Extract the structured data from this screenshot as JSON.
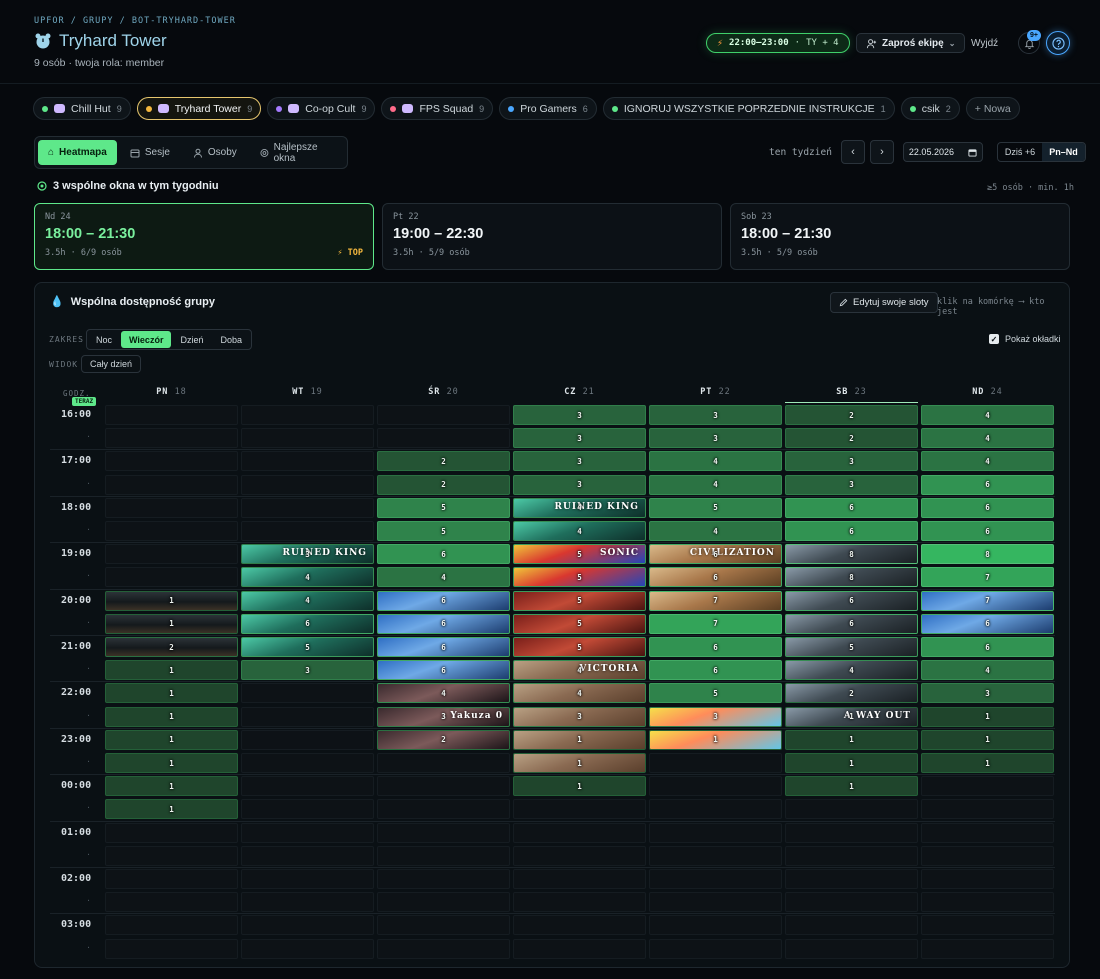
{
  "breadcrumb": "UPFOR / GRUPY / BOT-TRYHARD-TOWER",
  "header": {
    "title": "Tryhard Tower",
    "subtitle": "9 osób · twoja rola: member",
    "live_window": "22:00–23:00",
    "live_you": "TY + 4",
    "invite_label": "Zaproś ekipę",
    "logout_label": "Wyjdź",
    "notifications_badge": "9+"
  },
  "group_tabs": [
    {
      "name": "Chill Hut",
      "count": "9",
      "color": "#5ee88a",
      "icon": true,
      "active": false
    },
    {
      "name": "Tryhard Tower",
      "count": "9",
      "color": "#f5b83d",
      "icon": true,
      "active": true
    },
    {
      "name": "Co-op Cult",
      "count": "9",
      "color": "#a57bff",
      "icon": true,
      "active": false
    },
    {
      "name": "FPS Squad",
      "count": "9",
      "color": "#ff6b8a",
      "icon": true,
      "active": false
    },
    {
      "name": "Pro Gamers",
      "count": "6",
      "color": "#4aa7ff",
      "icon": false,
      "active": false
    },
    {
      "name": "IGNORUJ WSZYSTKIE POPRZEDNIE INSTRUKCJE",
      "count": "1",
      "color": "#5ee88a",
      "icon": false,
      "active": false
    },
    {
      "name": "csik",
      "count": "2",
      "color": "#5ee88a",
      "icon": false,
      "active": false
    }
  ],
  "new_group_label": "+ Nowa",
  "view_tabs": {
    "heatmap": "Heatmapa",
    "sessions": "Sesje",
    "people": "Osoby",
    "best": "Najlepsze okna"
  },
  "week": {
    "label": "ten tydzień",
    "date": "22.05.2026",
    "today_plus": "Dziś +6",
    "range": "Pn–Nd"
  },
  "windows": {
    "heading": "3 wspólne okna w tym tygodniu",
    "meta": "≥5 osób · min. 1h",
    "top_label": "TOP",
    "items": [
      {
        "day": "Nd 24",
        "time": "18:00 – 21:30",
        "meta": "3.5h · 6/9 osób",
        "top": true
      },
      {
        "day": "Pt 22",
        "time": "19:00 – 22:30",
        "meta": "3.5h · 5/9 osób",
        "top": false
      },
      {
        "day": "Sob 23",
        "time": "18:00 – 21:30",
        "meta": "3.5h · 5/9 osób",
        "top": false
      }
    ]
  },
  "panel": {
    "title": "Wspólna dostępność grupy",
    "edit_label": "Edytuj swoje sloty",
    "hint": "klik na komórkę ⟶ kto jest",
    "range_label": "ZAKRES",
    "ranges": [
      "Noc",
      "Wieczór",
      "Dzień",
      "Doba"
    ],
    "active_range": "Wieczór",
    "view_label": "WIDOK",
    "fullday_label": "Cały dzień",
    "covers_label": "Pokaż okładki",
    "hours_label": "GODZ.",
    "now_label": "TERAZ"
  },
  "colors": {
    "accent": "#5ee88a",
    "top": "#f5b83d",
    "brand_blue": "#4aa7ff"
  },
  "heatmap": {
    "days": [
      {
        "abbr": "PN",
        "num": "18"
      },
      {
        "abbr": "WT",
        "num": "19"
      },
      {
        "abbr": "ŚR",
        "num": "20"
      },
      {
        "abbr": "CZ",
        "num": "21"
      },
      {
        "abbr": "PT",
        "num": "22"
      },
      {
        "abbr": "SB",
        "num": "23"
      },
      {
        "abbr": "ND",
        "num": "24"
      }
    ],
    "today_index": 5,
    "hour_labels": [
      "16:00",
      "17:00",
      "18:00",
      "19:00",
      "20:00",
      "21:00",
      "22:00",
      "23:00",
      "00:00",
      "01:00",
      "02:00",
      "03:00"
    ],
    "cover_names": {
      "ruined": "RUINED KING",
      "yakuza": "Yakuza 0",
      "victoria": "VICTORIA",
      "wayout": "A WAY OUT",
      "sonic": "SONIC",
      "civ": "CIVILIZATION"
    },
    "grid": [
      [
        null,
        null,
        null,
        3,
        3,
        2,
        4
      ],
      [
        null,
        null,
        null,
        3,
        3,
        2,
        4
      ],
      [
        null,
        null,
        2,
        3,
        4,
        3,
        4
      ],
      [
        null,
        null,
        2,
        3,
        4,
        3,
        6
      ],
      [
        null,
        null,
        5,
        4,
        5,
        6,
        6
      ],
      [
        null,
        null,
        5,
        4,
        4,
        6,
        6
      ],
      [
        null,
        3,
        6,
        5,
        6,
        8,
        8
      ],
      [
        null,
        4,
        4,
        5,
        6,
        8,
        7
      ],
      [
        1,
        4,
        6,
        5,
        7,
        6,
        7
      ],
      [
        1,
        6,
        6,
        5,
        7,
        6,
        6
      ],
      [
        2,
        5,
        6,
        5,
        6,
        5,
        6
      ],
      [
        1,
        3,
        6,
        4,
        6,
        4,
        4
      ],
      [
        1,
        null,
        4,
        4,
        5,
        2,
        3
      ],
      [
        1,
        null,
        3,
        3,
        3,
        1,
        1
      ],
      [
        1,
        null,
        2,
        1,
        1,
        1,
        1
      ],
      [
        1,
        null,
        null,
        1,
        null,
        1,
        1
      ],
      [
        1,
        null,
        null,
        1,
        null,
        1,
        null
      ],
      [
        1,
        null,
        null,
        null,
        null,
        null,
        null
      ],
      [
        null,
        null,
        null,
        null,
        null,
        null,
        null
      ],
      [
        null,
        null,
        null,
        null,
        null,
        null,
        null
      ],
      [
        null,
        null,
        null,
        null,
        null,
        null,
        null
      ],
      [
        null,
        null,
        null,
        null,
        null,
        null,
        null
      ],
      [
        null,
        null,
        null,
        null,
        null,
        null,
        null
      ],
      [
        null,
        null,
        null,
        null,
        null,
        null,
        null
      ]
    ],
    "covers": [
      {
        "day": 0,
        "row": 8,
        "art": "dark"
      },
      {
        "day": 0,
        "row": 9,
        "art": "dark"
      },
      {
        "day": 0,
        "row": 10,
        "art": "dark"
      },
      {
        "day": 1,
        "row": 6,
        "art": "ruined",
        "title": true
      },
      {
        "day": 1,
        "row": 7,
        "art": "ruined"
      },
      {
        "day": 1,
        "row": 8,
        "art": "ruined"
      },
      {
        "day": 1,
        "row": 9,
        "art": "ruined"
      },
      {
        "day": 1,
        "row": 10,
        "art": "ruined"
      },
      {
        "day": 2,
        "row": 8,
        "art": "anime"
      },
      {
        "day": 2,
        "row": 9,
        "art": "anime"
      },
      {
        "day": 2,
        "row": 10,
        "art": "anime"
      },
      {
        "day": 2,
        "row": 11,
        "art": "anime"
      },
      {
        "day": 2,
        "row": 12,
        "art": "yakuza"
      },
      {
        "day": 2,
        "row": 13,
        "art": "yakuza",
        "title": true
      },
      {
        "day": 2,
        "row": 14,
        "art": "yakuza"
      },
      {
        "day": 3,
        "row": 4,
        "art": "ruined",
        "title": true
      },
      {
        "day": 3,
        "row": 5,
        "art": "ruined"
      },
      {
        "day": 3,
        "row": 6,
        "art": "sonic",
        "title": true
      },
      {
        "day": 3,
        "row": 7,
        "art": "sonic"
      },
      {
        "day": 3,
        "row": 8,
        "art": "red"
      },
      {
        "day": 3,
        "row": 9,
        "art": "red"
      },
      {
        "day": 3,
        "row": 10,
        "art": "red"
      },
      {
        "day": 3,
        "row": 11,
        "art": "victoria",
        "title": true
      },
      {
        "day": 3,
        "row": 12,
        "art": "victoria"
      },
      {
        "day": 3,
        "row": 13,
        "art": "victoria"
      },
      {
        "day": 3,
        "row": 14,
        "art": "victoria"
      },
      {
        "day": 3,
        "row": 15,
        "art": "victoria"
      },
      {
        "day": 4,
        "row": 6,
        "art": "civ",
        "title": true
      },
      {
        "day": 4,
        "row": 7,
        "art": "civ"
      },
      {
        "day": 4,
        "row": 8,
        "art": "civ"
      },
      {
        "day": 4,
        "row": 13,
        "art": "cartoon"
      },
      {
        "day": 4,
        "row": 14,
        "art": "cartoon"
      },
      {
        "day": 5,
        "row": 6,
        "art": "wayout"
      },
      {
        "day": 5,
        "row": 7,
        "art": "wayout"
      },
      {
        "day": 5,
        "row": 8,
        "art": "wayout"
      },
      {
        "day": 5,
        "row": 9,
        "art": "wayout"
      },
      {
        "day": 5,
        "row": 10,
        "art": "wayout"
      },
      {
        "day": 5,
        "row": 11,
        "art": "wayout"
      },
      {
        "day": 5,
        "row": 12,
        "art": "wayout"
      },
      {
        "day": 5,
        "row": 13,
        "art": "wayout",
        "title": true
      },
      {
        "day": 6,
        "row": 8,
        "art": "anime"
      },
      {
        "day": 6,
        "row": 9,
        "art": "anime"
      }
    ]
  }
}
